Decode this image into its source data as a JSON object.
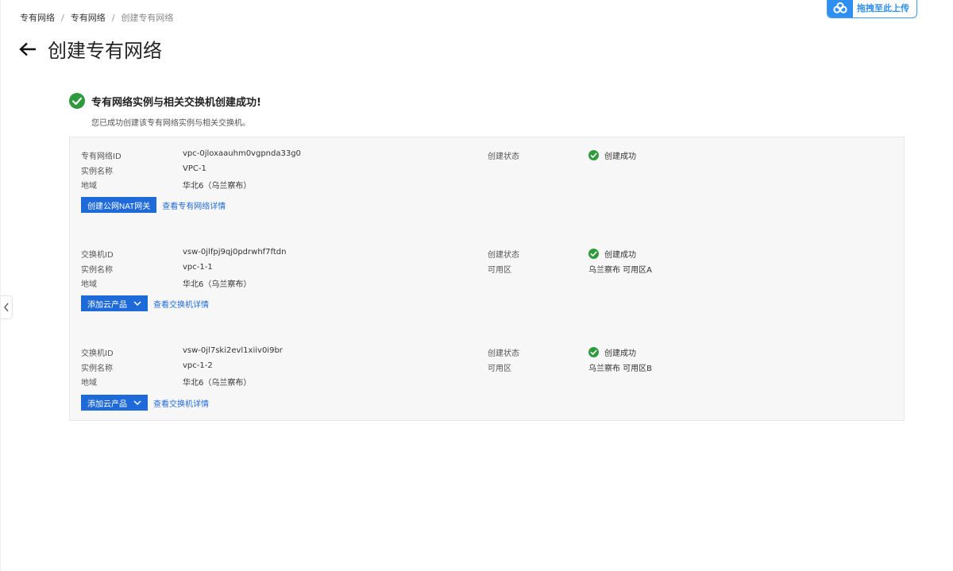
{
  "breadcrumb": {
    "items": [
      "专有网络",
      "专有网络",
      "创建专有网络"
    ],
    "separator": "/"
  },
  "upload": {
    "label": "拖拽至此上传",
    "icon": "cloud-upload-icon"
  },
  "header": {
    "title": "创建专有网络",
    "back_icon": "back-arrow-icon"
  },
  "success": {
    "title": "专有网络实例与相关交换机创建成功!",
    "description": "您已成功创建该专有网络实例与相关交换机。"
  },
  "vpc": {
    "id_label": "专有网络ID",
    "id_value": "vpc-0jloxaauhm0vgpnda33g0",
    "name_label": "实例名称",
    "name_value": "VPC-1",
    "region_label": "地域",
    "region_value": "华北6（乌兰察布）",
    "status_label": "创建状态",
    "status_value": "创建成功",
    "primary_button": "创建公网NAT网关",
    "detail_link": "查看专有网络详情"
  },
  "vswitches": [
    {
      "id_label": "交换机ID",
      "id_value": "vsw-0jlfpj9qj0pdrwhf7ftdn",
      "name_label": "实例名称",
      "name_value": "vpc-1-1",
      "region_label": "地域",
      "region_value": "华北6（乌兰察布）",
      "status_label": "创建状态",
      "status_value": "创建成功",
      "zone_label": "可用区",
      "zone_value": "乌兰察布 可用区A",
      "primary_button": "添加云产品",
      "detail_link": "查看交换机详情"
    },
    {
      "id_label": "交换机ID",
      "id_value": "vsw-0jl7ski2evl1xiiv0i9br",
      "name_label": "实例名称",
      "name_value": "vpc-1-2",
      "region_label": "地域",
      "region_value": "华北6（乌兰察布）",
      "status_label": "创建状态",
      "status_value": "创建成功",
      "zone_label": "可用区",
      "zone_value": "乌兰察布 可用区B",
      "primary_button": "添加云产品",
      "detail_link": "查看交换机详情"
    }
  ],
  "colors": {
    "primary": "#1f6ad9",
    "success": "#2e9a3c",
    "upload_accent": "#2f8ff0"
  }
}
